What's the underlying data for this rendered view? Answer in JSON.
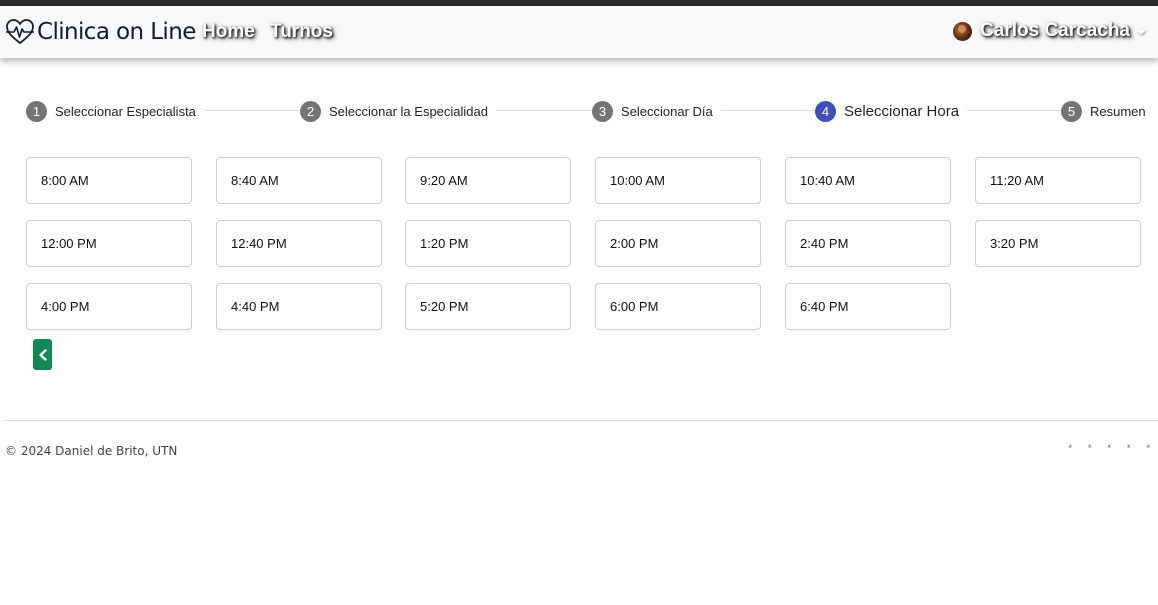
{
  "navbar": {
    "brand": "Clinica on Line",
    "links": [
      "Home",
      "Turnos"
    ],
    "user_name": "Carlos Carcacha"
  },
  "stepper": {
    "steps": [
      {
        "number": "1",
        "label": "Seleccionar Especialista",
        "active": false
      },
      {
        "number": "2",
        "label": "Seleccionar la Especialidad",
        "active": false
      },
      {
        "number": "3",
        "label": "Seleccionar Día",
        "active": false
      },
      {
        "number": "4",
        "label": "Seleccionar Hora",
        "active": true
      },
      {
        "number": "5",
        "label": "Resumen",
        "active": false
      }
    ]
  },
  "time_slots": [
    "8:00 AM",
    "8:40 AM",
    "9:20 AM",
    "10:00 AM",
    "10:40 AM",
    "11:20 AM",
    "12:00 PM",
    "12:40 PM",
    "1:20 PM",
    "2:00 PM",
    "2:40 PM",
    "3:20 PM",
    "4:00 PM",
    "4:40 PM",
    "5:20 PM",
    "6:00 PM",
    "6:40 PM"
  ],
  "footer": {
    "copyright": "© 2024 Daniel de Brito, UTN",
    "stars": [
      "*",
      "*",
      "*",
      "*",
      "*"
    ]
  },
  "colors": {
    "active_step": "#3f51b5",
    "inactive_step": "#747474",
    "back_button": "#108a55",
    "brand_text": "#0d1b3e"
  },
  "icons": {
    "brand": "heart-pulse-icon",
    "back": "chevron-left-icon"
  }
}
